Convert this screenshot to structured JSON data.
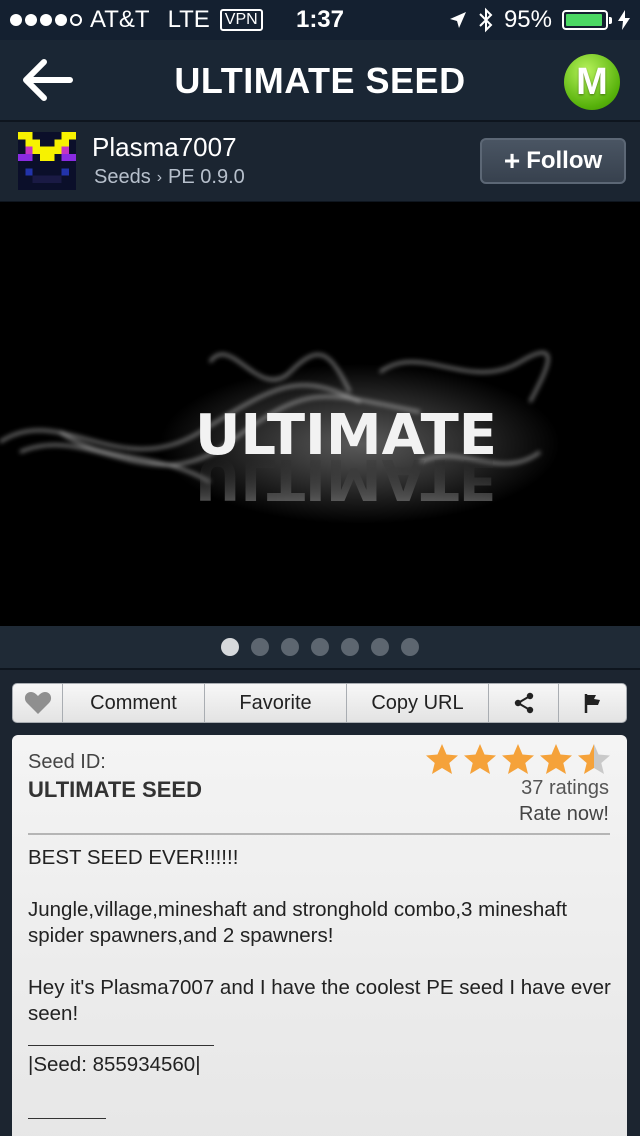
{
  "status_bar": {
    "carrier": "AT&T",
    "network": "LTE",
    "vpn": "VPN",
    "time": "1:37",
    "battery": "95%",
    "battery_level": 0.95,
    "signal_bars_filled": 4,
    "signal_bars_total": 5
  },
  "nav": {
    "title": "ULTIMATE SEED",
    "logo_letter": "M"
  },
  "author": {
    "name": "Plasma7007",
    "breadcrumb": [
      "Seeds",
      "PE 0.9.0"
    ],
    "breadcrumb_sep": "›",
    "follow_label": "Follow",
    "follow_prefix": "+"
  },
  "hero": {
    "image_text": "ULTIMATE",
    "page_count": 7,
    "active_page": 0
  },
  "actions": {
    "comment": "Comment",
    "favorite": "Favorite",
    "copy_url": "Copy URL"
  },
  "seed": {
    "id_label": "Seed ID:",
    "id_value": "ULTIMATE SEED",
    "rating": 4.5,
    "rating_max": 5,
    "ratings_count": "37 ratings",
    "rate_now": "Rate now!",
    "star_color": "#f5a23a",
    "description": [
      "BEST SEED EVER!!!!!!",
      "Jungle,village,mineshaft and stronghold combo,3 mineshaft spider spawners,and 2 spawners!",
      "Hey it's Plasma7007 and I have the coolest PE seed I have ever seen!"
    ],
    "seed_line": "|Seed: 855934560|"
  },
  "colors": {
    "nav_bg": "#1a2634",
    "accent_green": "#56b10a",
    "battery_green": "#4cd964"
  }
}
